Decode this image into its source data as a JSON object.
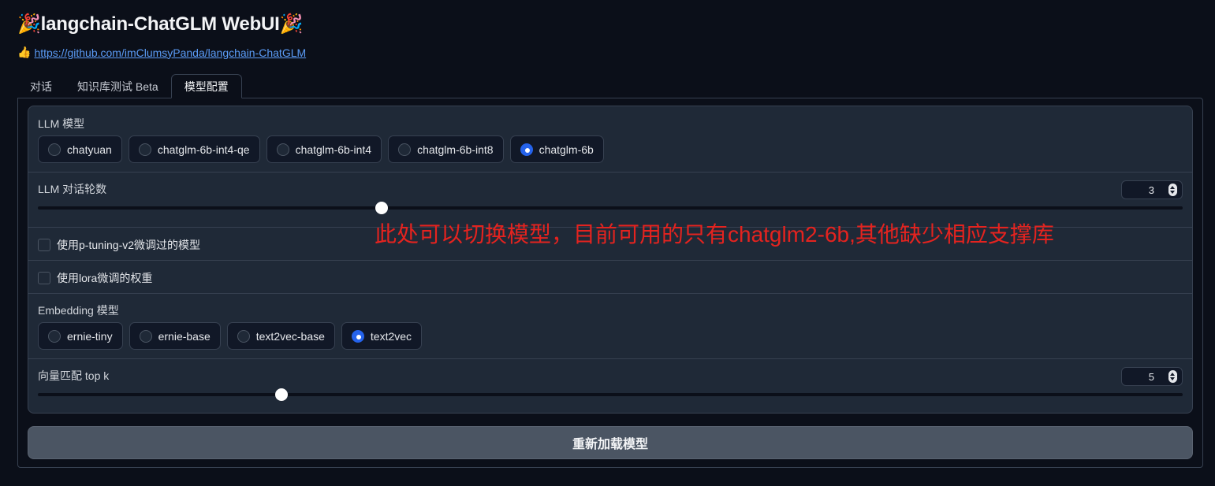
{
  "header": {
    "title": "🎉langchain-ChatGLM WebUI🎉",
    "link_icon": "👍",
    "link_text": "https://github.com/imClumsyPanda/langchain-ChatGLM"
  },
  "tabs": [
    {
      "label": "对话",
      "active": false
    },
    {
      "label": "知识库测试 Beta",
      "active": false
    },
    {
      "label": "模型配置",
      "active": true
    }
  ],
  "llm_model": {
    "label": "LLM 模型",
    "options": [
      "chatyuan",
      "chatglm-6b-int4-qe",
      "chatglm-6b-int4",
      "chatglm-6b-int8",
      "chatglm-6b"
    ],
    "selected": "chatglm-6b"
  },
  "history_len": {
    "label": "LLM 对话轮数",
    "value": "3",
    "slider_fraction": 0.3
  },
  "use_ptuning": {
    "label": "使用p-tuning-v2微调过的模型",
    "checked": false
  },
  "use_lora": {
    "label": "使用lora微调的权重",
    "checked": false
  },
  "embedding_model": {
    "label": "Embedding 模型",
    "options": [
      "ernie-tiny",
      "ernie-base",
      "text2vec-base",
      "text2vec"
    ],
    "selected": "text2vec"
  },
  "top_k": {
    "label": "向量匹配 top k",
    "value": "5",
    "slider_fraction": 0.213
  },
  "annotation": "此处可以切换模型，目前可用的只有chatglm2-6b,其他缺少相应支撑库",
  "reload_button": "重新加载模型",
  "colors": {
    "background": "#0b0f19",
    "panel": "#1f2937",
    "accent": "#2563eb",
    "annotation": "#e4231f",
    "link": "#5b9cf7"
  }
}
